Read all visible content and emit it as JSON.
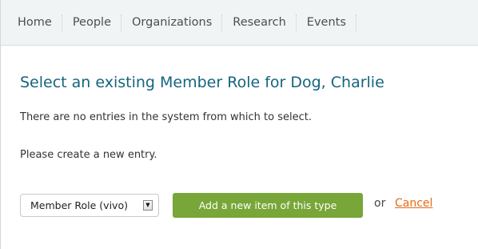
{
  "nav": {
    "items": [
      {
        "label": "Home"
      },
      {
        "label": "People"
      },
      {
        "label": "Organizations"
      },
      {
        "label": "Research"
      },
      {
        "label": "Events"
      }
    ]
  },
  "page": {
    "title": "Select an existing Member Role for Dog, Charlie",
    "message_1": "There are no entries in the system from which to select.",
    "message_2": "Please create a new entry."
  },
  "form": {
    "type_select_value": "Member Role (vivo)",
    "add_button_label": "Add a new item of this type",
    "or_text": "or",
    "cancel_label": "Cancel"
  },
  "colors": {
    "title": "#14657e",
    "button": "#78a638",
    "cancel_link": "#e56b16",
    "nav_background": "#f0f4f5"
  }
}
